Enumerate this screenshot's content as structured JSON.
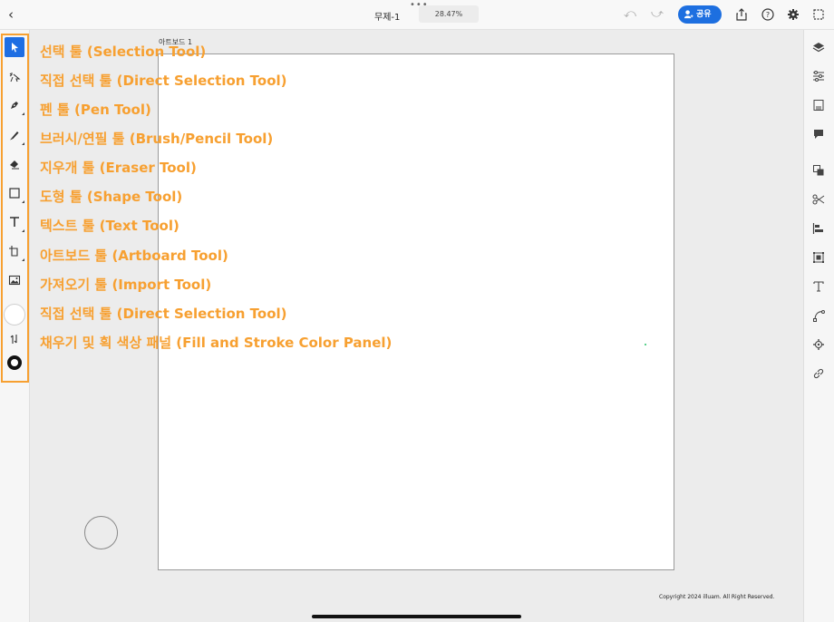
{
  "topbar": {
    "back_icon": "chevron-left-icon",
    "doc_title": "무제-1",
    "zoom": "28.47%",
    "share_label": "공유",
    "icons": [
      "undo-icon",
      "redo-icon",
      "share-export-icon",
      "help-icon",
      "settings-icon",
      "artboards-icon"
    ]
  },
  "artboard": {
    "label": "아트보드 1"
  },
  "annotations": [
    "선택 툴 (Selection Tool)",
    "직접 선택 툴 (Direct Selection Tool)",
    "펜 툴 (Pen Tool)",
    "브러시/연필 툴 (Brush/Pencil Tool)",
    "지우개 툴 (Eraser Tool)",
    "도형 툴 (Shape Tool)",
    "텍스트 툴 (Text Tool)",
    "아트보드 툴 (Artboard Tool)",
    "가져오기 툴 (Import Tool)",
    "직접 선택 툴 (Direct Selection Tool)",
    "채우기 및 획 색상 패널 (Fill and Stroke Color Panel)"
  ],
  "tools": [
    "selection-tool",
    "direct-selection-tool",
    "pen-tool",
    "brush-tool",
    "eraser-tool",
    "shape-tool",
    "text-tool",
    "artboard-tool",
    "import-tool",
    "fill-swatch",
    "swap-colors",
    "stroke-swatch"
  ],
  "right_panel_icons": [
    "layers-icon",
    "properties-icon",
    "libraries-icon",
    "comments-icon",
    "arrange-icon",
    "cut-icon",
    "align-icon",
    "transform-icon",
    "type-icon",
    "path-icon",
    "settings-gear-icon",
    "link-icon"
  ],
  "accent_color": "#f7a031",
  "share_color": "#1d6fe0",
  "footer": {
    "copyright": "Copyright 2024 illuam. All Right Reserved."
  }
}
